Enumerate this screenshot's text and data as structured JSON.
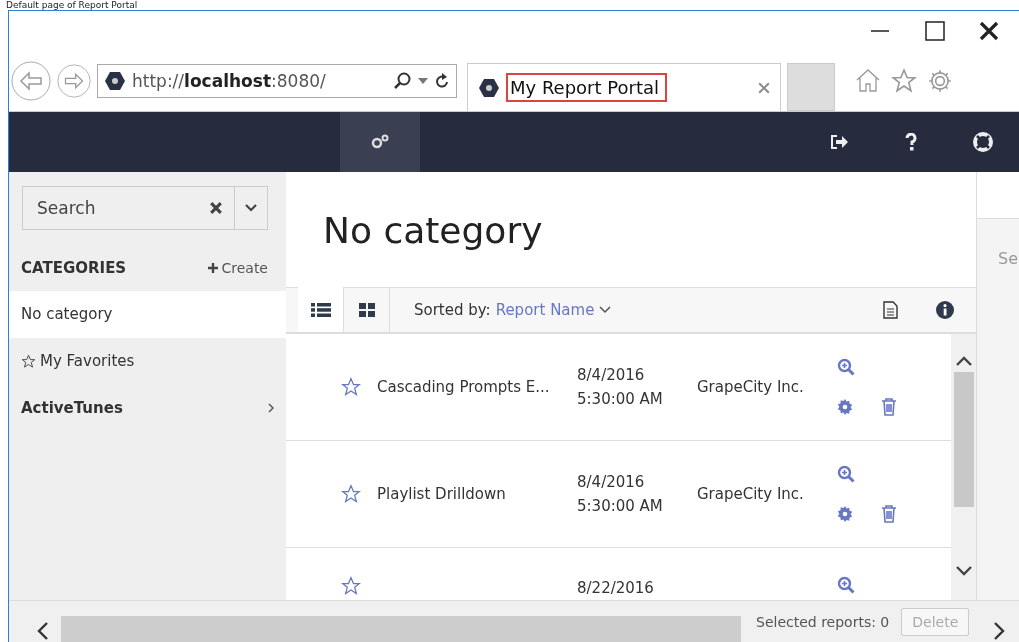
{
  "caption": "Default page of Report Portal",
  "browser": {
    "address": "http://**localhost**:8080/",
    "tab_title": "My Report Portal"
  },
  "sidebar": {
    "search_placeholder": "Search",
    "heading": "CATEGORIES",
    "create": "Create",
    "items": [
      {
        "label": "No category",
        "kind": "plain",
        "selected": true
      },
      {
        "label": "My Favorites",
        "kind": "favorites",
        "selected": false
      },
      {
        "label": "ActiveTunes",
        "kind": "folder",
        "selected": false
      }
    ]
  },
  "main": {
    "title": "No category",
    "view_modes": [
      {
        "kind": "list",
        "selected": true
      },
      {
        "kind": "grid",
        "selected": false
      }
    ],
    "sort_label": "Sorted by:",
    "sort_value": "Report Name",
    "reports": [
      {
        "kind": "full",
        "name": "Cascading Prompts E...",
        "date": "8/4/2016",
        "time": "5:30:00 AM",
        "author": "GrapeCity Inc."
      },
      {
        "kind": "full",
        "name": "Playlist Drilldown",
        "date": "8/4/2016",
        "time": "5:30:00 AM",
        "author": "GrapeCity Inc."
      },
      {
        "kind": "cut",
        "date": "8/22/2016"
      }
    ]
  },
  "right_panel": {
    "text": "Se"
  },
  "footer": {
    "selected": "Selected reports: 0",
    "delete": "Delete",
    "delete_disabled": true
  }
}
